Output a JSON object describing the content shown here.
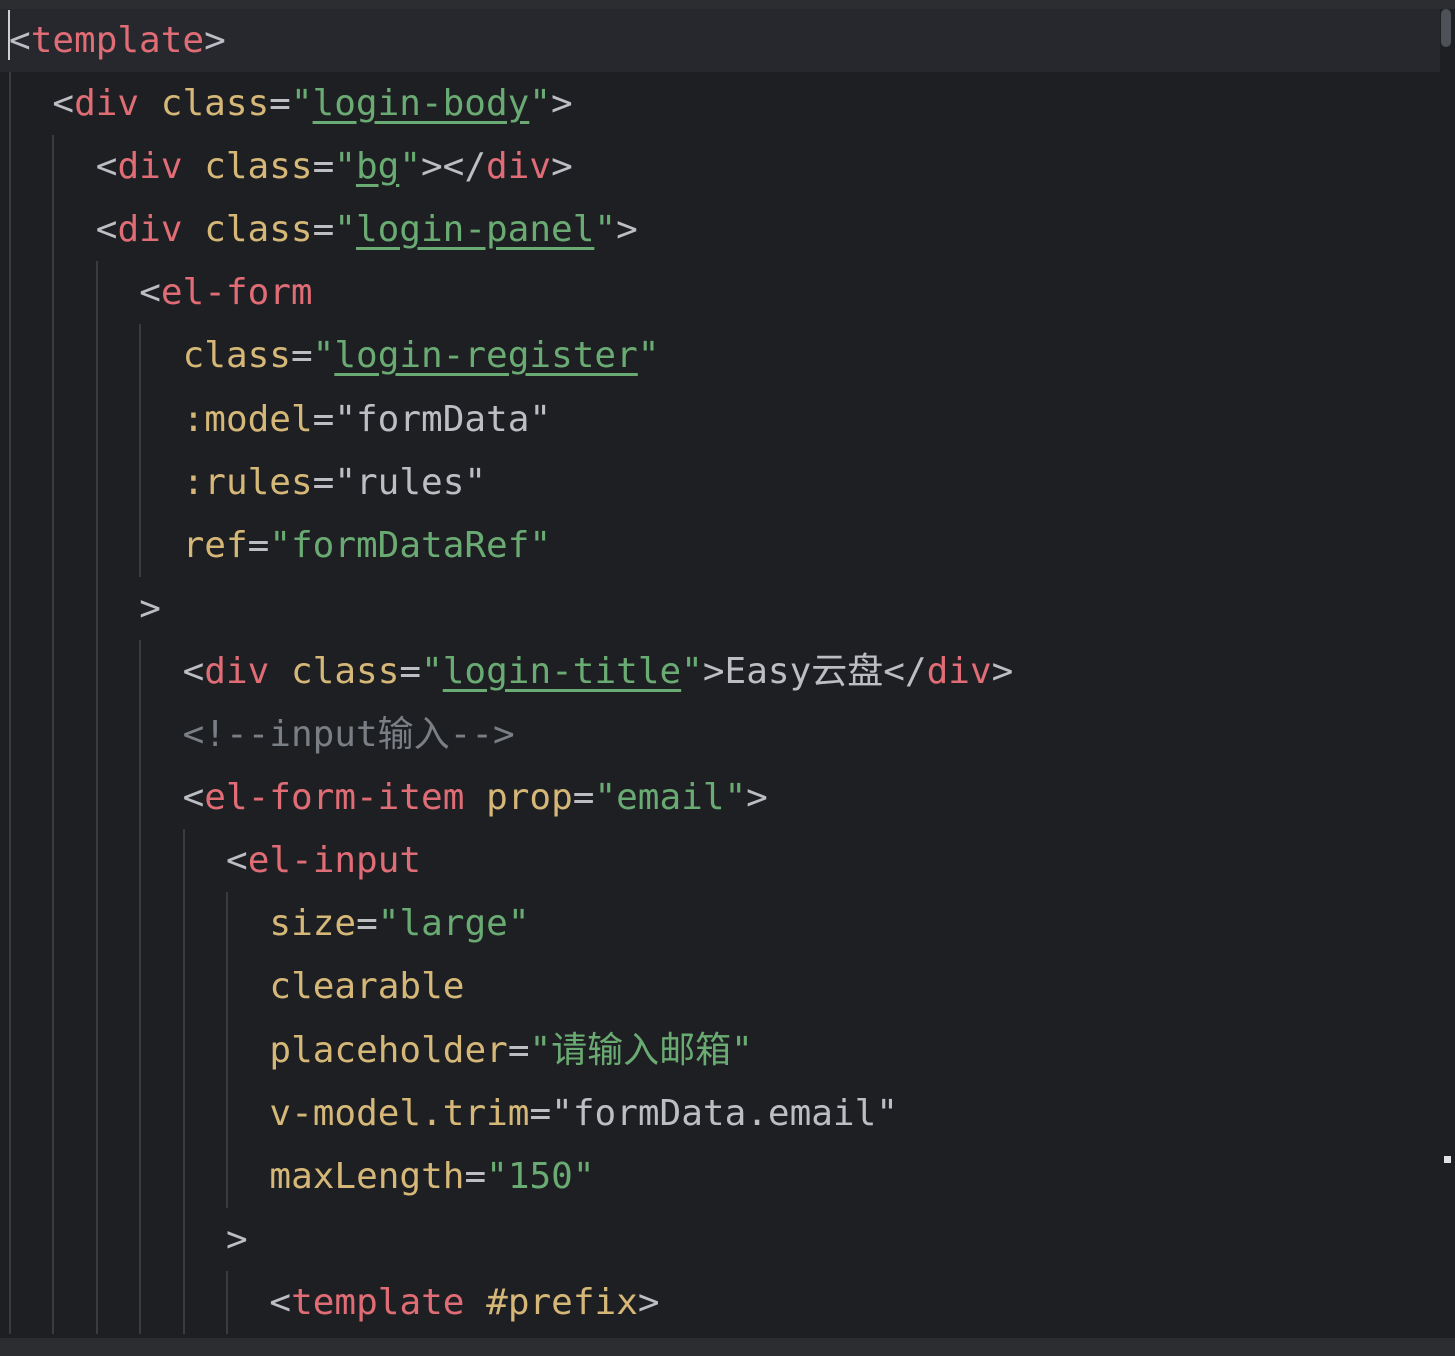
{
  "editor": {
    "lines": [
      {
        "indent": 0,
        "current": true,
        "tokens": [
          {
            "t": "<",
            "c": "br"
          },
          {
            "t": "template",
            "c": "tn2"
          },
          {
            "t": ">",
            "c": "br"
          }
        ]
      },
      {
        "indent": 1,
        "tokens": [
          {
            "t": "<",
            "c": "br"
          },
          {
            "t": "div",
            "c": "tn2"
          },
          {
            "t": " ",
            "c": "br"
          },
          {
            "t": "class",
            "c": "attr"
          },
          {
            "t": "=",
            "c": "eq"
          },
          {
            "t": "\"",
            "c": "str"
          },
          {
            "t": "login-body",
            "c": "cls"
          },
          {
            "t": "\"",
            "c": "str"
          },
          {
            "t": ">",
            "c": "br"
          }
        ]
      },
      {
        "indent": 2,
        "tokens": [
          {
            "t": "<",
            "c": "br"
          },
          {
            "t": "div",
            "c": "tn2"
          },
          {
            "t": " ",
            "c": "br"
          },
          {
            "t": "class",
            "c": "attr"
          },
          {
            "t": "=",
            "c": "eq"
          },
          {
            "t": "\"",
            "c": "str"
          },
          {
            "t": "bg",
            "c": "cls"
          },
          {
            "t": "\"",
            "c": "str"
          },
          {
            "t": "></",
            "c": "br"
          },
          {
            "t": "div",
            "c": "tn2"
          },
          {
            "t": ">",
            "c": "br"
          }
        ]
      },
      {
        "indent": 2,
        "tokens": [
          {
            "t": "<",
            "c": "br"
          },
          {
            "t": "div",
            "c": "tn2"
          },
          {
            "t": " ",
            "c": "br"
          },
          {
            "t": "class",
            "c": "attr"
          },
          {
            "t": "=",
            "c": "eq"
          },
          {
            "t": "\"",
            "c": "str"
          },
          {
            "t": "login-panel",
            "c": "cls"
          },
          {
            "t": "\"",
            "c": "str"
          },
          {
            "t": ">",
            "c": "br"
          }
        ]
      },
      {
        "indent": 3,
        "tokens": [
          {
            "t": "<",
            "c": "br"
          },
          {
            "t": "el-form",
            "c": "tn2"
          }
        ]
      },
      {
        "indent": 4,
        "tokens": [
          {
            "t": "class",
            "c": "attr"
          },
          {
            "t": "=",
            "c": "eq"
          },
          {
            "t": "\"",
            "c": "str"
          },
          {
            "t": "login-register",
            "c": "cls"
          },
          {
            "t": "\"",
            "c": "str"
          }
        ]
      },
      {
        "indent": 4,
        "tokens": [
          {
            "t": ":model",
            "c": "attr"
          },
          {
            "t": "=",
            "c": "eq"
          },
          {
            "t": "\"formData\"",
            "c": "val"
          }
        ]
      },
      {
        "indent": 4,
        "tokens": [
          {
            "t": ":rules",
            "c": "attr"
          },
          {
            "t": "=",
            "c": "eq"
          },
          {
            "t": "\"rules\"",
            "c": "val"
          }
        ]
      },
      {
        "indent": 4,
        "tokens": [
          {
            "t": "ref",
            "c": "attr"
          },
          {
            "t": "=",
            "c": "eq"
          },
          {
            "t": "\"formDataRef\"",
            "c": "str"
          }
        ]
      },
      {
        "indent": 3,
        "tokens": [
          {
            "t": ">",
            "c": "br"
          }
        ]
      },
      {
        "indent": 4,
        "tokens": [
          {
            "t": "<",
            "c": "br"
          },
          {
            "t": "div",
            "c": "tn2"
          },
          {
            "t": " ",
            "c": "br"
          },
          {
            "t": "class",
            "c": "attr"
          },
          {
            "t": "=",
            "c": "eq"
          },
          {
            "t": "\"",
            "c": "str"
          },
          {
            "t": "login-title",
            "c": "cls"
          },
          {
            "t": "\"",
            "c": "str"
          },
          {
            "t": ">",
            "c": "br"
          },
          {
            "t": "Easy云盘",
            "c": "txt"
          },
          {
            "t": "</",
            "c": "br"
          },
          {
            "t": "div",
            "c": "tn2"
          },
          {
            "t": ">",
            "c": "br"
          }
        ]
      },
      {
        "indent": 4,
        "tokens": [
          {
            "t": "<!--input输入-->",
            "c": "cmt"
          }
        ]
      },
      {
        "indent": 4,
        "tokens": [
          {
            "t": "<",
            "c": "br"
          },
          {
            "t": "el-form-item",
            "c": "tn2"
          },
          {
            "t": " ",
            "c": "br"
          },
          {
            "t": "prop",
            "c": "attr"
          },
          {
            "t": "=",
            "c": "eq"
          },
          {
            "t": "\"email\"",
            "c": "str"
          },
          {
            "t": ">",
            "c": "br"
          }
        ]
      },
      {
        "indent": 5,
        "tokens": [
          {
            "t": "<",
            "c": "br"
          },
          {
            "t": "el-input",
            "c": "tn2"
          }
        ]
      },
      {
        "indent": 6,
        "tokens": [
          {
            "t": "size",
            "c": "attr"
          },
          {
            "t": "=",
            "c": "eq"
          },
          {
            "t": "\"large\"",
            "c": "str"
          }
        ]
      },
      {
        "indent": 6,
        "tokens": [
          {
            "t": "clearable",
            "c": "attr"
          }
        ]
      },
      {
        "indent": 6,
        "tokens": [
          {
            "t": "placeholder",
            "c": "attr"
          },
          {
            "t": "=",
            "c": "eq"
          },
          {
            "t": "\"请输入邮箱\"",
            "c": "str"
          }
        ]
      },
      {
        "indent": 6,
        "tokens": [
          {
            "t": "v-model.trim",
            "c": "attr"
          },
          {
            "t": "=",
            "c": "eq"
          },
          {
            "t": "\"formData.email\"",
            "c": "val"
          }
        ]
      },
      {
        "indent": 6,
        "tokens": [
          {
            "t": "maxLength",
            "c": "attr"
          },
          {
            "t": "=",
            "c": "eq"
          },
          {
            "t": "\"150\"",
            "c": "str"
          }
        ]
      },
      {
        "indent": 5,
        "tokens": [
          {
            "t": ">",
            "c": "br"
          }
        ]
      },
      {
        "indent": 6,
        "tokens": [
          {
            "t": "<",
            "c": "br"
          },
          {
            "t": "template",
            "c": "tn2"
          },
          {
            "t": " ",
            "c": "br"
          },
          {
            "t": "#prefix",
            "c": "attr"
          },
          {
            "t": ">",
            "c": "br"
          }
        ]
      }
    ]
  }
}
